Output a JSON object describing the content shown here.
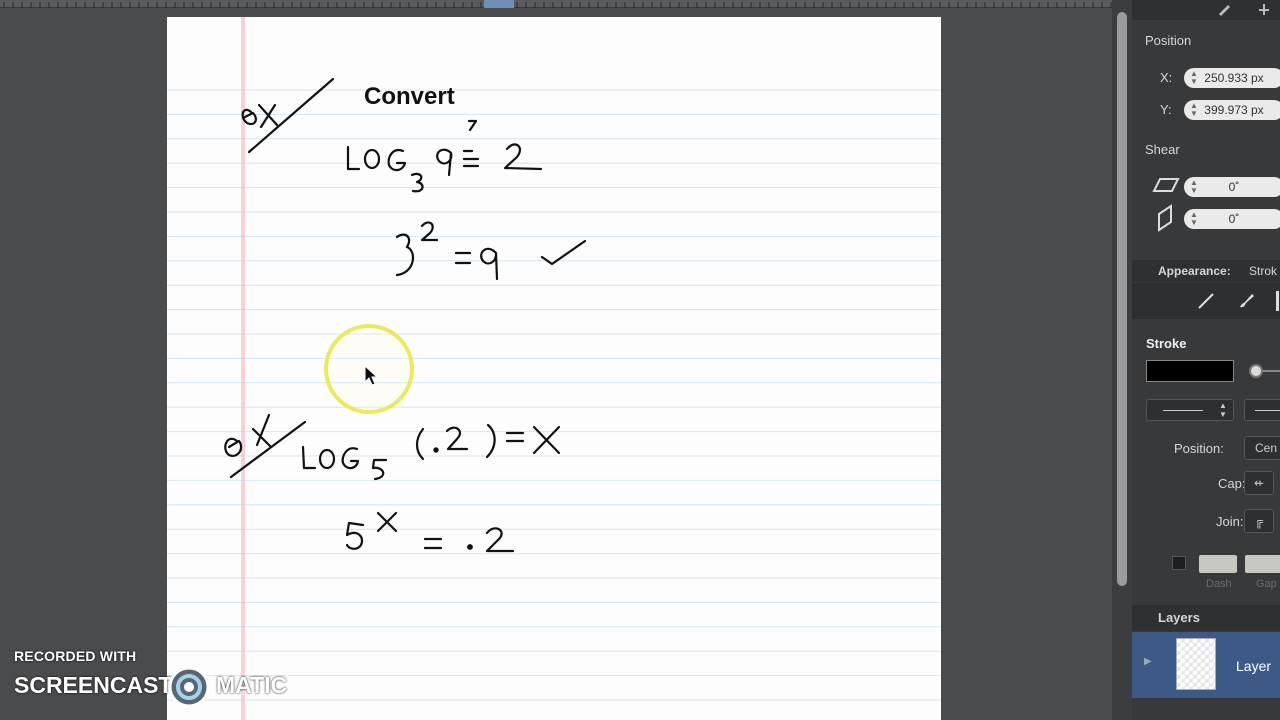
{
  "document": {
    "heading": "Convert"
  },
  "watermark": {
    "line1": "RECORDED WITH",
    "brand_left": "SCREENCAST",
    "brand_right": "MATIC"
  },
  "inspector": {
    "position_title": "Position",
    "x_label": "X:",
    "x_value": "250.933 px",
    "y_label": "Y:",
    "y_value": "399.973 px",
    "shear_title": "Shear",
    "shear_h_value": "0˚",
    "shear_v_value": "0˚",
    "appearance_label": "Appearance:",
    "appearance_value": "Strok",
    "stroke_title": "Stroke",
    "position_label": "Position:",
    "position_value": "Cen",
    "cap_label": "Cap:",
    "join_label": "Join:",
    "dash_label": "Dash",
    "gap_label": "Gap",
    "layers_title": "Layers",
    "layer_name": "Layer"
  },
  "colors": {
    "margin_line": "#f0a8b4",
    "rule_line": "#d6e6f2",
    "ink": "#111111",
    "highlight": "#ecea5a",
    "layer_selected": "#3d5a86"
  },
  "icons": [
    "pencil-icon",
    "plus-icon",
    "shear-horizontal-icon",
    "shear-vertical-icon",
    "line-tool-icon",
    "brush-tool-icon",
    "cursor-arrow-icon",
    "disclosure-triangle-icon"
  ]
}
